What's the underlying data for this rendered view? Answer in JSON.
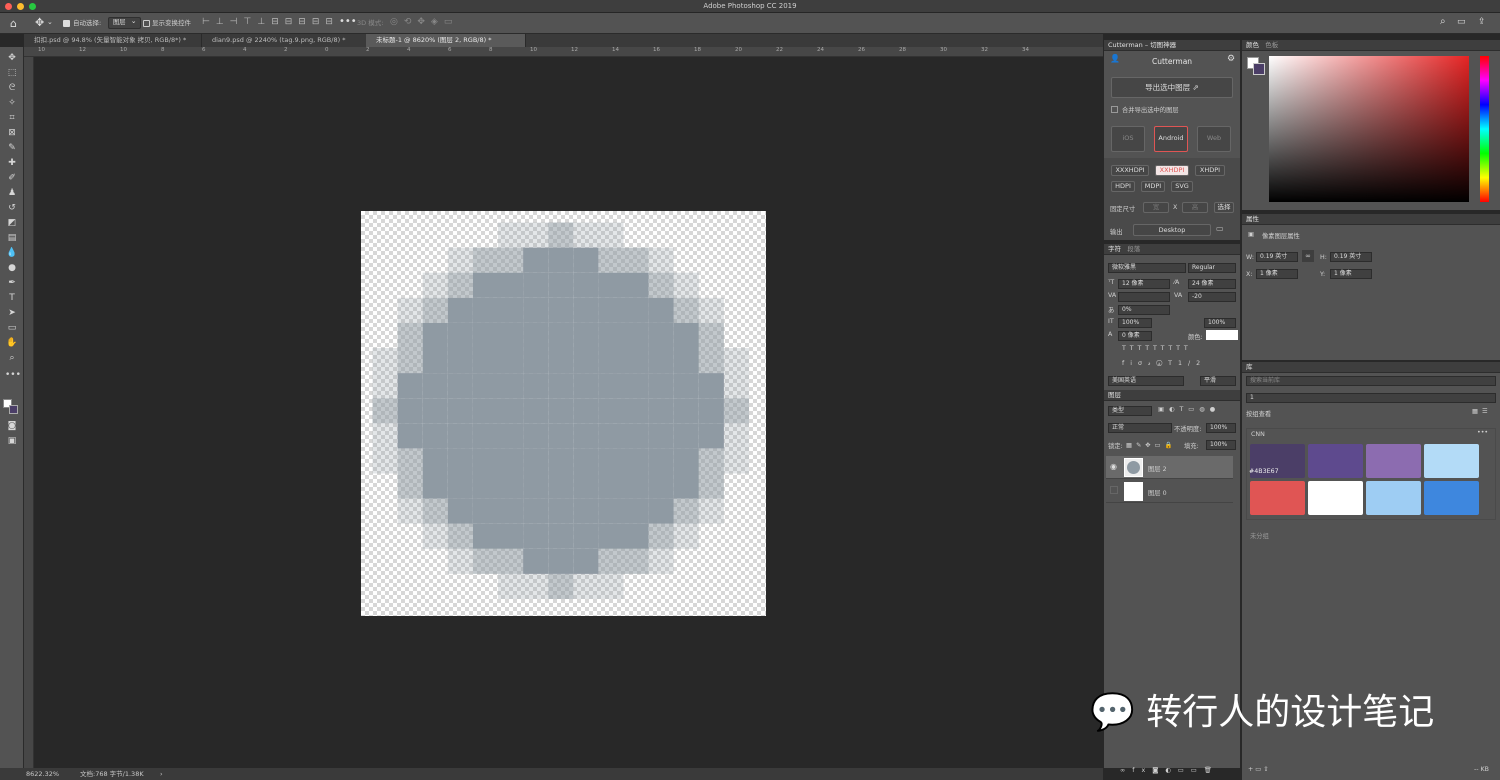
{
  "window": {
    "title": "Adobe Photoshop CC 2019"
  },
  "options_bar": {
    "auto_select_label": "自动选择:",
    "auto_select_value": "图层",
    "show_transform_label": "显示变换控件",
    "mode_3d_label": "3D 模式:"
  },
  "tabs": [
    {
      "label": "扣扣.psd @ 94.8% (矢量智能对象 拷贝, RGB/8*) *"
    },
    {
      "label": "dian9.psd @ 2240% (tag.9.png, RGB/8) *"
    },
    {
      "label": "未标题-1 @ 8620% (图层 2, RGB/8) *"
    }
  ],
  "ruler_ticks": [
    "10",
    "12",
    "10",
    "8",
    "6",
    "4",
    "2",
    "0",
    "2",
    "4",
    "6",
    "8",
    "10",
    "12",
    "14",
    "16",
    "18",
    "20",
    "22",
    "24",
    "26",
    "28",
    "30",
    "32",
    "34"
  ],
  "status": {
    "zoom": "8622.32%",
    "doc": "文档:768 字节/1.38K"
  },
  "cutterman": {
    "tab_title": "Cutterman – 切图神器",
    "header": "Cutterman",
    "export_button": "导出选中图层",
    "merge_label": "合并导出选中的图层",
    "platforms": [
      "iOS",
      "Android",
      "Web"
    ],
    "densities_row1": [
      "XXXHDPI",
      "XXHDPI",
      "XHDPI"
    ],
    "densities_row2": [
      "HDPI",
      "MDPI",
      "SVG"
    ],
    "size_label": "固定尺寸",
    "width_ph": "宽",
    "x_label": "X",
    "height_ph": "高",
    "choose_button": "选择",
    "output_label": "输出",
    "output_value": "Desktop"
  },
  "character": {
    "tabs": [
      "字符",
      "段落"
    ],
    "font": "微软雅黑",
    "style": "Regular",
    "size": "12 像素",
    "leading": "24 像素",
    "tracking": "-20",
    "scale_pct": "0%",
    "vscale": "100%",
    "hscale": "100%",
    "baseline": "0 像素",
    "color_label": "颜色:",
    "language": "美国英语",
    "aa": "平滑"
  },
  "layers": {
    "tab": "图层",
    "filter_type": "类型",
    "blend": "正常",
    "opacity_label": "不透明度:",
    "opacity": "100%",
    "lock_label": "锁定:",
    "fill_label": "填充:",
    "fill": "100%",
    "items": [
      {
        "name": "图层 2",
        "selected": true
      },
      {
        "name": "图层 0",
        "selected": false
      }
    ]
  },
  "color_panel": {
    "tabs": [
      "颜色",
      "色板"
    ]
  },
  "properties": {
    "tab": "属性",
    "title": "像素图层属性",
    "w_label": "W:",
    "w": "0.19 英寸",
    "h_label": "H:",
    "h": "0.19 英寸",
    "x_label": "X:",
    "x": "1 像素",
    "y_label": "Y:",
    "y": "1 像素"
  },
  "library": {
    "tab": "库",
    "search_placeholder": "搜索当前库",
    "library_name": "1",
    "view_by": "按组查看",
    "group": "CNN",
    "hover_label": "#4B3E67",
    "swatches": [
      "#4B3E67",
      "#5E4A8E",
      "#8C6CB0",
      "#B3DBF7",
      "#E05554",
      "#FFFFFF",
      "#9ECDF3",
      "#3E87DE"
    ],
    "ungrouped": "未分组",
    "size": "-- KB"
  },
  "watermark": "转行人的设计笔记",
  "icon_color": "#8f9aa3"
}
